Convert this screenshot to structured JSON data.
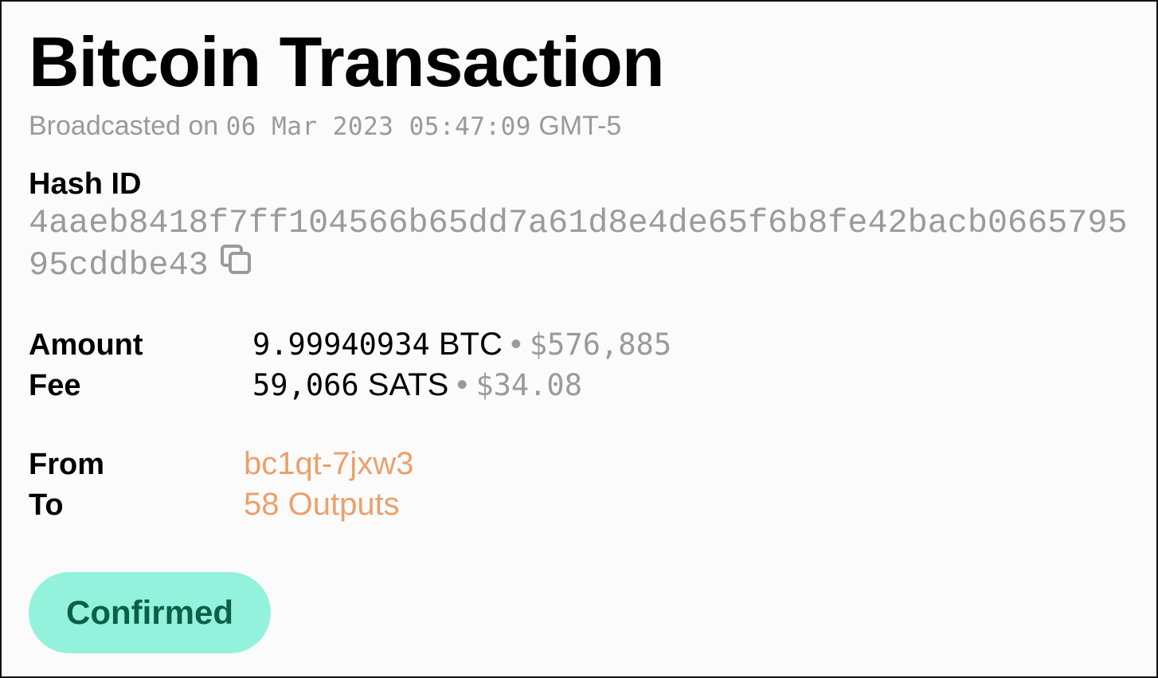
{
  "header": {
    "title": "Bitcoin Transaction",
    "broadcast_prefix": "Broadcasted on",
    "broadcast_date": "06 Mar 2023 05:47:09",
    "broadcast_tz": "GMT-5"
  },
  "hash": {
    "label": "Hash ID",
    "value": "4aaeb8418f7ff104566b65dd7a61d8e4de65f6b8fe42bacb066579595cddbe43",
    "copy_icon": "copy-icon"
  },
  "amount": {
    "label": "Amount",
    "value": "9.99940934",
    "unit": "BTC",
    "separator": "•",
    "usd": "$576,885"
  },
  "fee": {
    "label": "Fee",
    "value": "59,066",
    "unit": "SATS",
    "separator": "•",
    "usd": "$34.08"
  },
  "from": {
    "label": "From",
    "value": "bc1qt-7jxw3"
  },
  "to": {
    "label": "To",
    "value": "58 Outputs"
  },
  "status": {
    "label": "Confirmed"
  },
  "colors": {
    "link": "#eca06a",
    "badge_bg": "#93f2dc",
    "badge_text": "#0b5e47",
    "muted": "#9a9a9a"
  }
}
